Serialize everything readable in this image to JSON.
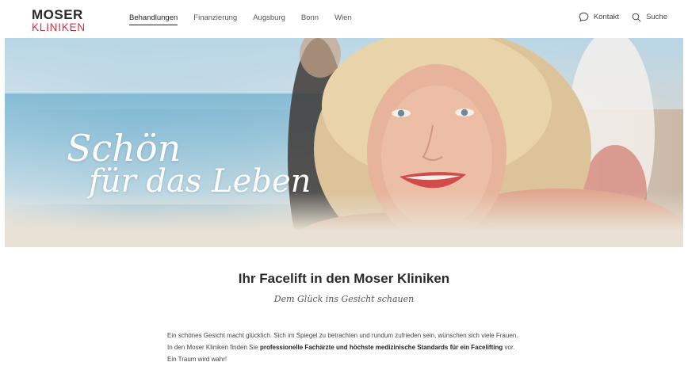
{
  "header": {
    "logo_top": "MOSER",
    "logo_bottom": "KLINIKEN",
    "nav": [
      {
        "label": "Behandlungen",
        "active": true
      },
      {
        "label": "Finanzierung",
        "active": false
      },
      {
        "label": "Augsburg",
        "active": false
      },
      {
        "label": "Bonn",
        "active": false
      },
      {
        "label": "Wien",
        "active": false
      }
    ],
    "contact_label": "Kontakt",
    "search_label": "Suche",
    "contact_icon": "chat-bubble-icon",
    "search_icon": "search-icon"
  },
  "hero": {
    "title_line1": "Schön",
    "title_line2": "für das Leben"
  },
  "main": {
    "headline": "Ihr Facelift in den Moser Kliniken",
    "subline": "Dem Glück ins Gesicht schauen",
    "intro_part1": "Ein schönes Gesicht macht glücklich. Sich im Spiegel zu betrachten und rundum zufrieden sein, wünschen sich viele Frauen. In den Moser Kliniken finden Sie ",
    "intro_bold": "professionelle Fachärzte und höchste medizinische Standards für ein Facelifting",
    "intro_part2": " vor. Ein Traum wird wahr!"
  },
  "colors": {
    "brand_red": "#d4303b",
    "text_dark": "#2a2a2a"
  }
}
